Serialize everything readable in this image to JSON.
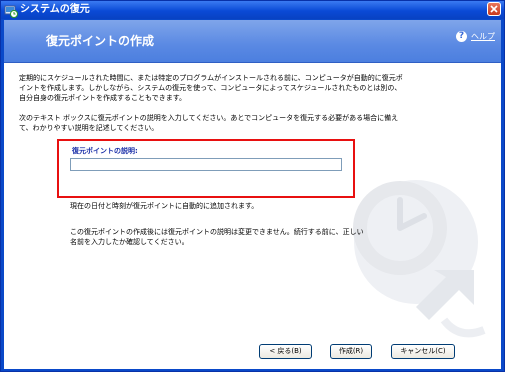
{
  "window": {
    "title": "システムの復元"
  },
  "header": {
    "page_title": "復元ポイントの作成",
    "help_link": "ヘルプ"
  },
  "content": {
    "paragraph1": "定期的にスケジュールされた時間に、または特定のプログラムがインストールされる前に、コンピュータが自動的に復元ポイントを作成します。しかしながら、システムの復元を使って、コンピュータによってスケジュールされたものとは別の、自分自身の復元ポイントを作成することもできます。",
    "paragraph2": "次のテキスト ボックスに復元ポイントの説明を入力してください。あとでコンピュータを復元する必要がある場合に備えて、わかりやすい説明を記述してください。",
    "field_label": "復元ポイントの説明:",
    "field_value": "",
    "note1": "現在の日付と時刻が復元ポイントに自動的に追加されます。",
    "note2": "この復元ポイントの作成後には復元ポイントの説明は変更できません。続行する前に、正しい名前を入力したか確認してください。"
  },
  "buttons": {
    "back": "< 戻る(B)",
    "create": "作成(R)",
    "cancel": "キャンセル(C)"
  },
  "colors": {
    "titlebar": "#0a49c9",
    "header": "#5a89e3",
    "highlight_box": "#e81010",
    "field_label": "#1a2fa8"
  },
  "icons": [
    "app-restore-icon",
    "close-icon",
    "help-icon",
    "clock-arrow-background-art"
  ]
}
